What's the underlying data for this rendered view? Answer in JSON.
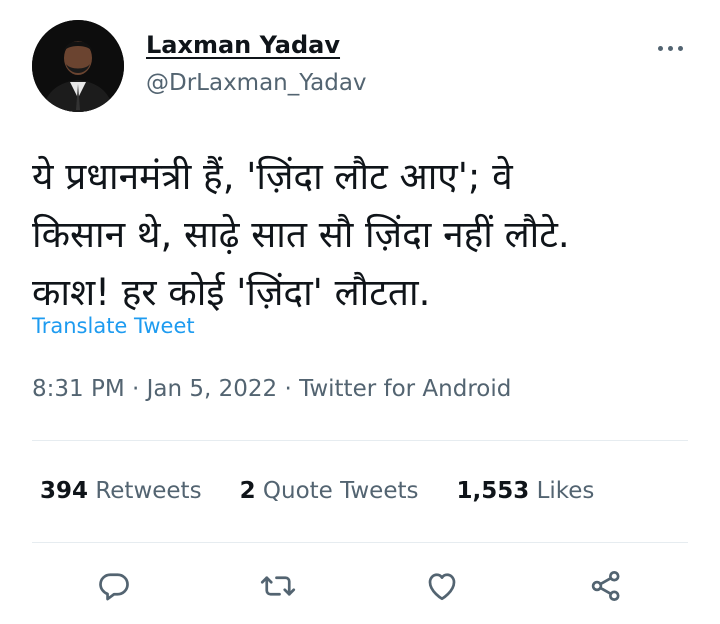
{
  "author": {
    "display_name": "Laxman Yadav",
    "handle": "@DrLaxman_Yadav",
    "avatar_icon": "profile-photo"
  },
  "tweet": {
    "text": "ये प्रधानमंत्री हैं, 'ज़िंदा लौट आए'; वे\nकिसान थे, साढ़े सात सौ ज़िंदा नहीं लौटे.\nकाश! हर कोई 'ज़िंदा' लौटता.",
    "translate_label": "Translate Tweet",
    "timestamp": "8:31 PM · Jan 5, 2022 · Twitter for Android"
  },
  "stats": {
    "retweets": {
      "count": "394",
      "label": "Retweets"
    },
    "quote_tweets": {
      "count": "2",
      "label": "Quote Tweets"
    },
    "likes": {
      "count": "1,553",
      "label": "Likes"
    }
  },
  "actions": [
    "reply-icon",
    "retweet-icon",
    "like-icon",
    "share-icon"
  ],
  "colors": {
    "text_primary": "#0f1419",
    "text_secondary": "#536471",
    "link": "#1d9bf0",
    "divider": "#e6ecf0"
  }
}
